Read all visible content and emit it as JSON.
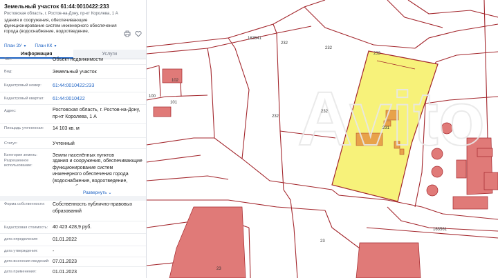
{
  "panel": {
    "title": "Земельный участок 61:44:0010422:233",
    "address": "Ростовская область, г. Ростов-на-Дону, пр-кт Королева, 1 А",
    "description": "здания и сооружения, обеспечивающие функционирование систем инженерного обеспечения города (водоснабжение, водоотведение, энергоснабжение, газоснабжение, теплоснабжение,...",
    "plan_zu": "План ЗУ",
    "plan_kk": "План КК",
    "tabs": {
      "info": "Информация",
      "services": "Услуги"
    },
    "rows": [
      {
        "label": "Тип:",
        "value": "Объект недвижимости"
      },
      {
        "label": "Вид:",
        "value": "Земельный участок"
      },
      {
        "label": "Кадастровый номер:",
        "value": "61:44:0010422:233"
      },
      {
        "label": "Кадастровый квартал:",
        "value": "61:44:0010422"
      },
      {
        "label": "Адрес:",
        "value": "Ростовская область, г. Ростов-на-Дону, пр-кт Королева, 1 А"
      },
      {
        "label": "Площадь уточненная:",
        "value": "14 103 кв. м"
      },
      {
        "label": "Статус:",
        "value": "Учтенный"
      },
      {
        "label": "Категория земель:",
        "value": "Земли населённых пунктов"
      },
      {
        "label": "Разрешенное использование:",
        "value": "здания и сооружения, обеспечивающие функционирование систем инженерного обеспечения города (водоснабжение, водоотведение, энергоснабжение,"
      },
      {
        "label": "Форма собственности:",
        "value": "Собственность публично-правовых образований"
      },
      {
        "label": "Кадастровая стоимость:",
        "value": "40 423 428,9 руб."
      },
      {
        "label": "дата определения:",
        "value": "01.01.2022"
      },
      {
        "label": "дата утверждения:",
        "value": "-"
      },
      {
        "label": "дата внесения сведений:",
        "value": "07.01.2023"
      },
      {
        "label": "дата применения:",
        "value": "01.01.2023"
      }
    ],
    "expand_label": "Развернуть"
  },
  "map": {
    "parcel_labels": {
      "l163541": "163541",
      "l232a": "232",
      "l232b": "232",
      "l232c": "232",
      "l232d": "232",
      "l233": "233",
      "l231": "231",
      "l102": "102",
      "l101": "101",
      "l100": "100",
      "l163561": "163561",
      "l23a": "23",
      "l23b": "23"
    },
    "highlight_color": "#f7f27a",
    "building_color": "#e07a78",
    "boundary_color": "#a3262c",
    "watermark": "Avito"
  }
}
